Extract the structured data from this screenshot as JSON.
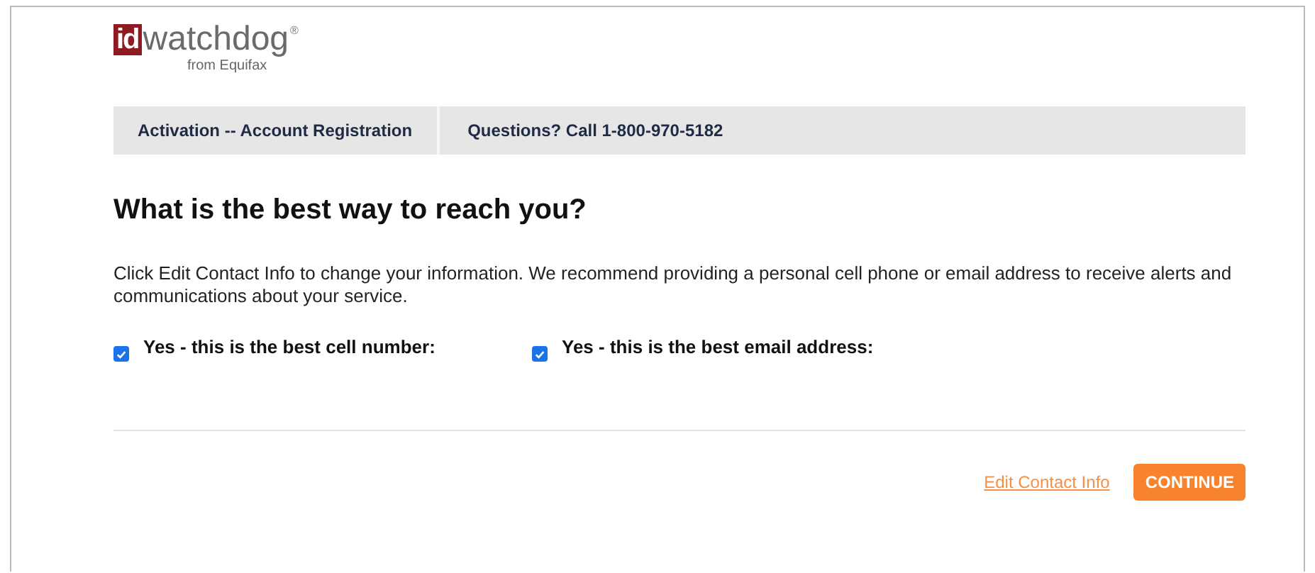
{
  "logo": {
    "mark": "id",
    "name": "watchdog",
    "registered": "®",
    "tagline": "from Equifax"
  },
  "header_bar": [
    {
      "label": "Activation -- Account Registration"
    },
    {
      "label": "Questions? Call 1-800-970-5182"
    }
  ],
  "heading": "What is the best way to reach you?",
  "intro": "Click Edit Contact Info to change your information. We recommend providing a personal cell phone or email address to receive alerts and communications about your service.",
  "options": [
    {
      "label": "Yes - this is the best cell number:",
      "checked": true
    },
    {
      "label": "Yes - this is the best email address:",
      "checked": true
    }
  ],
  "actions": {
    "link": "Edit Contact Info",
    "button": "CONTINUE"
  }
}
